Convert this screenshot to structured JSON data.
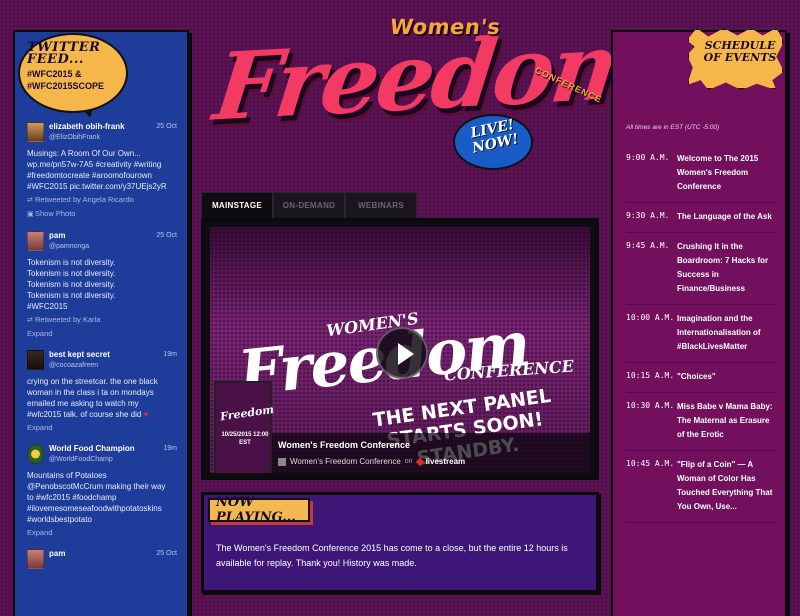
{
  "twitter": {
    "title": "Twitter Feed...",
    "hashtags": "#WFC2015 & #WFC2015SCOPE",
    "tweets": [
      {
        "name": "elizabeth obih-frank",
        "handle": "@ElizObihFrank",
        "time": "25 Oct",
        "lines": [
          "Musings: A Room Of Our Own...",
          "wp.me/pn57w-7A5 #creativity #writing",
          "#freedomtocreate #aroomofourown",
          "#WFC2015 pic.twitter.com/y37UEjs2yR"
        ],
        "meta1": "Retweeted by Angela Ricardo",
        "meta2": "Show Photo"
      },
      {
        "name": "pam",
        "handle": "@pamnonga",
        "time": "25 Oct",
        "lines": [
          "Tokenism is not diversity.",
          "Tokenism is not diversity.",
          "Tokenism is not diversity.",
          "Tokenism is not diversity.",
          "#WFC2015"
        ],
        "meta1": "Retweeted by Karla",
        "meta2": "Expand"
      },
      {
        "name": "best kept secret",
        "handle": "@cocoazafreen",
        "time": "19m",
        "lines": [
          "crying on the streetcar. the one black",
          "woman in the class i ta on mondays",
          "emailed me asking to watch my",
          "#wfc2015 talk. of course she did"
        ],
        "heart": "♥",
        "meta2": "Expand"
      },
      {
        "name": "World Food Champion",
        "handle": "@WorldFoodChamp",
        "time": "19m",
        "lines": [
          "Mountains of Potatoes",
          "@PenobscotMcCrum making their way",
          "to #wfc2015 #foodchamp",
          "#ilovemesomeseafoodwithpotatoskins",
          "#worldsbestpotato"
        ],
        "meta2": "Expand"
      },
      {
        "name": "pam",
        "handle": "",
        "time": "25 Oct"
      }
    ]
  },
  "logo": {
    "womens": "Women's",
    "freedom": "Freedom",
    "conference": "CONFERENCE",
    "live": "LIVE!",
    "now": "NOW!"
  },
  "tabs": [
    "MAINSTAGE",
    "ON-DEMAND",
    "WEBINARS"
  ],
  "video": {
    "womens": "WOMEN'S",
    "freedom": "Freedom",
    "conference": "CONFERENCE",
    "next": "THE NEXT PANEL STARTS SOON! STANDBY.",
    "thumb_title": "Freedom",
    "thumb_date": "10/25/2015 12:00 EST",
    "caption_title": "Women's Freedom Conference",
    "caption_channel": "Women's Freedom Conference",
    "caption_on": "on",
    "caption_platform": "livestream"
  },
  "now_playing": {
    "label": "Now Playing...",
    "text": "The Women's Freedom Conference 2015 has come to a close, but the entire 12 hours is available for replay. Thank you! History was made."
  },
  "schedule": {
    "title": "Schedule of Events",
    "note": "All times are in EST (UTC -5:00)",
    "items": [
      {
        "time": "9:00 A.M.",
        "event": "Welcome to The 2015 Women's Freedom Conference"
      },
      {
        "time": "9:30 A.M.",
        "event": "The Language of the Ask"
      },
      {
        "time": "9:45 A.M.",
        "event": "Crushing It in the Boardroom: 7 Hacks for Success in Finance/Business"
      },
      {
        "time": "10:00 A.M.",
        "event": "Imagination and the Internationalisation of #BlackLivesMatter"
      },
      {
        "time": "10:15 A.M.",
        "event": "\"Choices\""
      },
      {
        "time": "10:30 A.M.",
        "event": "Miss Babe v Mama Baby: The Maternal as Erasure of the Erotic"
      },
      {
        "time": "10:45 A.M.",
        "event": "\"Flip of a Coin\" — A Woman of Color Has Touched Everything That You Own, Use..."
      }
    ]
  }
}
